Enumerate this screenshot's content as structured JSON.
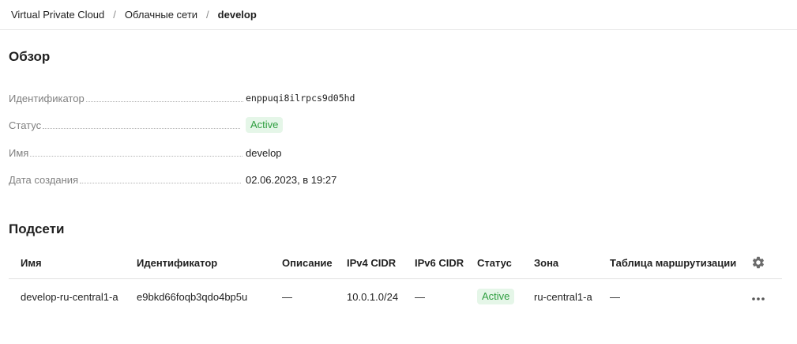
{
  "breadcrumb": {
    "items": [
      "Virtual Private Cloud",
      "Облачные сети",
      "develop"
    ],
    "separator": "/"
  },
  "overview": {
    "title": "Обзор",
    "fields": [
      {
        "label": "Идентификатор",
        "value": "enppuqi8ilrpcs9d05hd"
      },
      {
        "label": "Статус",
        "value": "Active"
      },
      {
        "label": "Имя",
        "value": "develop"
      },
      {
        "label": "Дата создания",
        "value": "02.06.2023, в 19:27"
      }
    ]
  },
  "subnets": {
    "title": "Подсети",
    "columns": [
      "Имя",
      "Идентификатор",
      "Описание",
      "IPv4 CIDR",
      "IPv6 CIDR",
      "Статус",
      "Зона",
      "Таблица маршрутизации"
    ],
    "rows": [
      {
        "name": "develop-ru-central1-a",
        "id": "e9bkd66foqb3qdo4bp5u",
        "description": "—",
        "ipv4": "10.0.1.0/24",
        "ipv6": "—",
        "status": "Active",
        "zone": "ru-central1-a",
        "route_table": "—"
      }
    ],
    "settings_icon": "gear-icon",
    "row_menu_icon": "more-horizontal-icon"
  },
  "colors": {
    "status_active_bg": "#e5f6e8",
    "status_active_text": "#2e9e3f"
  }
}
